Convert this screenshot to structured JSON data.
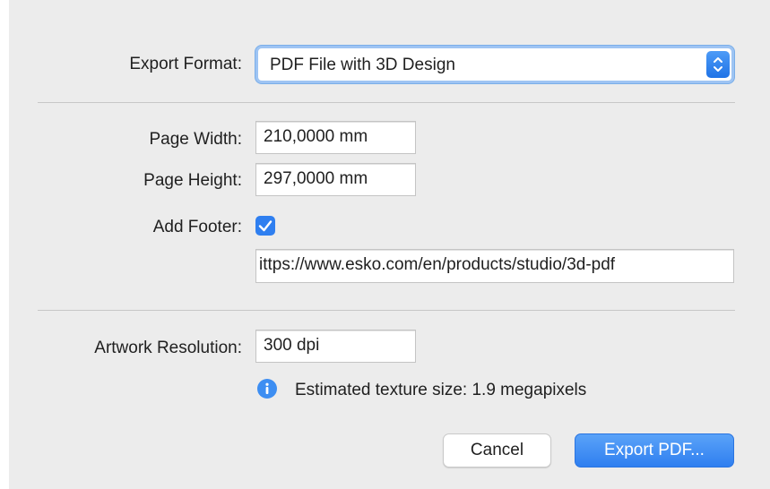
{
  "export_format": {
    "label": "Export Format:",
    "selected": "PDF File with 3D Design"
  },
  "page": {
    "width_label": "Page Width:",
    "width_value": "210,0000 mm",
    "height_label": "Page Height:",
    "height_value": "297,0000 mm"
  },
  "footer": {
    "label": "Add Footer:",
    "checked": true,
    "text_value": "ittps://www.esko.com/en/products/studio/3d-pdf"
  },
  "artwork": {
    "resolution_label": "Artwork Resolution:",
    "resolution_value": "300 dpi",
    "info_text": "Estimated texture size: 1.9 megapixels",
    "info_icon": "info-icon"
  },
  "buttons": {
    "cancel_label": "Cancel",
    "export_label": "Export PDF..."
  },
  "colors": {
    "accent": "#2f7ff0",
    "background": "#ececec"
  }
}
